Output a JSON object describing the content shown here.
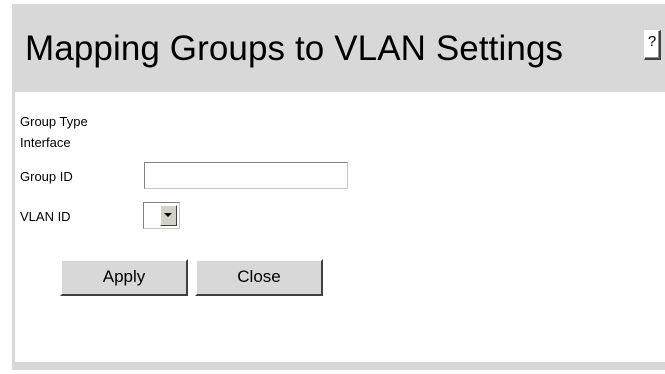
{
  "page": {
    "title": "Mapping Groups to VLAN Settings",
    "help_label": "?"
  },
  "form": {
    "group_type_label": "Group Type",
    "interface_label": "Interface",
    "group_id_label": "Group ID",
    "group_id_value": "",
    "vlan_id_label": "VLAN ID",
    "vlan_id_value": ""
  },
  "buttons": {
    "apply_label": "Apply",
    "close_label": "Close"
  },
  "colors": {
    "panel_gray": "#d8d8d8",
    "content_white": "#ffffff"
  }
}
